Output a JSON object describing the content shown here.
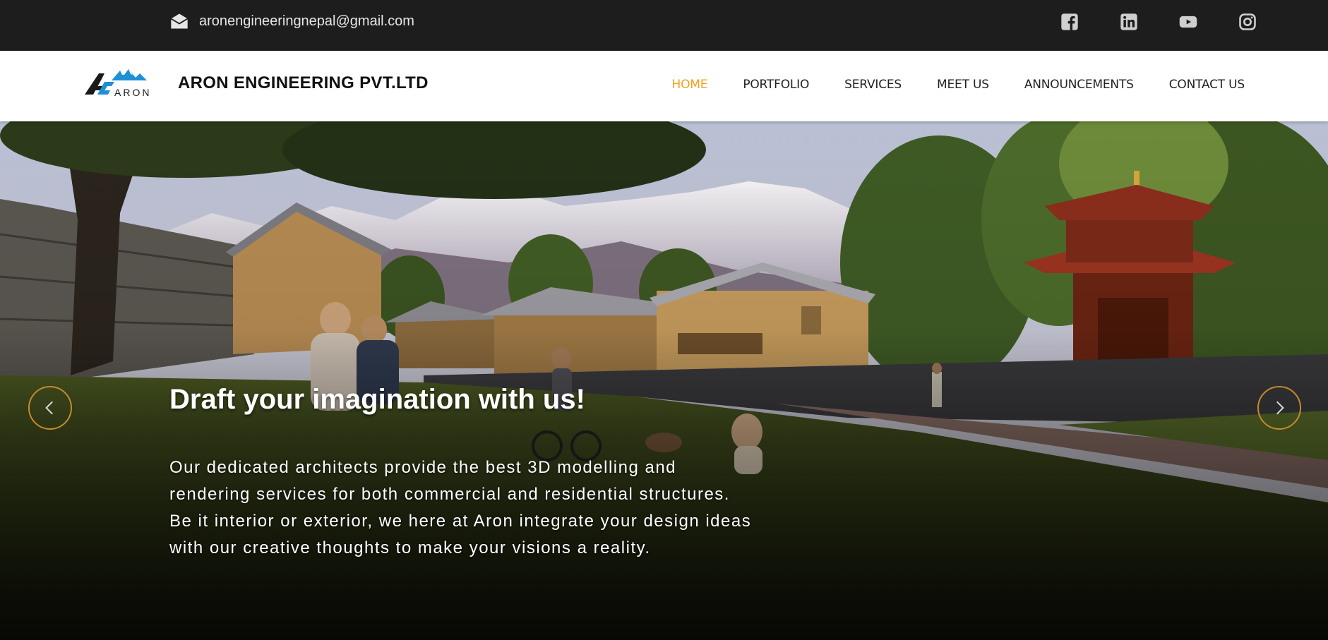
{
  "topbar": {
    "email": "aronengineeringnepal@gmail.com",
    "socials": [
      "facebook-icon",
      "linkedin-icon",
      "youtube-icon",
      "instagram-icon"
    ]
  },
  "brand": {
    "logo_text": "ARON",
    "name": "ARON ENGINEERING PVT.LTD"
  },
  "nav": {
    "items": [
      {
        "label": "HOME",
        "active": true
      },
      {
        "label": "PORTFOLIO"
      },
      {
        "label": "SERVICES"
      },
      {
        "label": "MEET US"
      },
      {
        "label": "ANNOUNCEMENTS"
      },
      {
        "label": "CONTACT US"
      }
    ]
  },
  "hero": {
    "heading": "Draft your imagination with us!",
    "lines": [
      "Our dedicated architects provide the best 3D modelling and",
      "rendering services for both commercial and residential structures.",
      "Be it interior or exterior, we here at Aron integrate your design ideas",
      "with our creative thoughts to make your visions a reality."
    ]
  },
  "colors": {
    "accent": "#f3a01f",
    "topbar_bg": "#1d1d1d",
    "logo_blue": "#1e90d6"
  }
}
